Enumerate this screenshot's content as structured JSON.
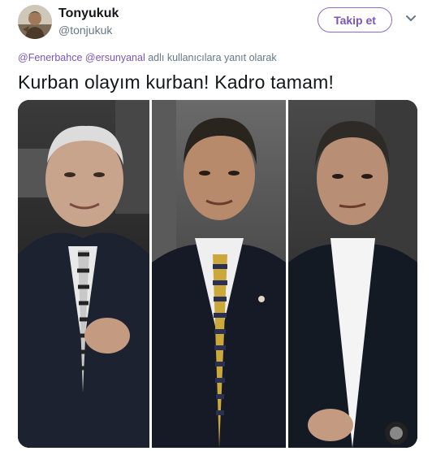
{
  "user": {
    "display_name": "Tonyukuk",
    "handle": "@tonjukuk",
    "avatar_icon": "avatar-portrait-icon"
  },
  "follow_button": {
    "label": "Takip et"
  },
  "menu_icon": "chevron-down-icon",
  "reply_context": {
    "mentions": [
      "@Fenerbahce",
      "@ersunyanal"
    ],
    "suffix": "adlı kullanıcılara yanıt olarak"
  },
  "tweet_text": "Kurban olayım kurban! Kadro tamam!",
  "media": {
    "description_icon": "photo-collage-icon",
    "panels": 3
  },
  "colors": {
    "accent": "#7a55b8",
    "secondary_text": "#657786",
    "primary_text": "#14171a"
  }
}
